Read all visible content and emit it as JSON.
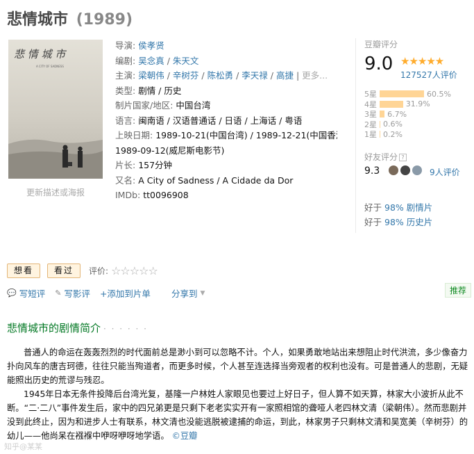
{
  "title": {
    "name": "悲情城市",
    "year": "(1989)"
  },
  "poster": {
    "update_link": "更新描述或海报"
  },
  "info": {
    "director": {
      "label": "导演:",
      "names": [
        "侯孝贤"
      ]
    },
    "writer": {
      "label": "编剧:",
      "names": [
        "吴念真",
        "朱天文"
      ]
    },
    "cast": {
      "label": "主演:",
      "names": [
        "梁朝伟",
        "辛树芬",
        "陈松勇",
        "李天禄",
        "高捷"
      ],
      "more": "更多..."
    },
    "genre": {
      "label": "类型:",
      "value": "剧情 / 历史"
    },
    "region": {
      "label": "制片国家/地区:",
      "value": "中国台湾"
    },
    "language": {
      "label": "语言:",
      "value": "闽南语 / 汉语普通话 / 日语 / 上海话 / 粤语"
    },
    "release": {
      "label": "上映日期:",
      "line1": "1989-10-21(中国台湾) / 1989-12-21(中国香港) /",
      "line2": "1989-09-12(威尼斯电影节)"
    },
    "runtime": {
      "label": "片长:",
      "value": "157分钟"
    },
    "aka": {
      "label": "又名:",
      "value": "A City of Sadness / A Cidade da Dor"
    },
    "imdb": {
      "label": "IMDb:",
      "value": "tt0096908"
    }
  },
  "rating": {
    "label": "豆瓣评分",
    "score": "9.0",
    "stars": "★★★★★",
    "votes": "127527人评价",
    "distribution": [
      {
        "label": "5星",
        "pct": "60.5%",
        "value": 60.5
      },
      {
        "label": "4星",
        "pct": "31.9%",
        "value": 31.9
      },
      {
        "label": "3星",
        "pct": "6.7%",
        "value": 6.7
      },
      {
        "label": "2星",
        "pct": "0.6%",
        "value": 0.6
      },
      {
        "label": "1星",
        "pct": "0.2%",
        "value": 0.2
      }
    ],
    "friend_label": "好友评分",
    "friend_help": "?",
    "friend_score": "9.3",
    "friend_count": "9人评价",
    "better": [
      {
        "prefix": "好于",
        "pct": "98%",
        "genre": "剧情片"
      },
      {
        "prefix": "好于",
        "pct": "98%",
        "genre": "历史片"
      }
    ]
  },
  "actions": {
    "want": "想看",
    "seen": "看过",
    "rate_label": "评价:",
    "empty_stars": "☆☆☆☆☆"
  },
  "links": {
    "short_review": "写短评",
    "review": "写影评",
    "add_list": "+添加到片单",
    "share": "分享到",
    "recommend": "推荐"
  },
  "synopsis": {
    "title": "悲情城市的剧情简介",
    "dots": "· · · · · ·",
    "p1": "普通人的命运在轰轰烈烈的时代面前总是渺小到可以忽略不计。个人，如果勇敢地站出来想阻止时代洪流，多少像奋力扑向风车的唐吉珂德，往往只能当殉道者，而更多时候，个人甚至连选择当旁观者的权利也没有。可是普通人的悲剧，无疑能照出历史的荒谬与残忍。",
    "p2": "1945年日本无条件投降后台湾光复，基隆一户林姓人家眼见也要过上好日子，但人算不如天算，林家大小波折从此不断。“二·二八”事件发生后，家中的四兄弟更是只剩下老老实实开有一家照相馆的聋哑人老四林文清（梁朝伟）。然而悲剧并没到此终止，因为和进步人士有联系，林文清也没能逃脱被逮捕的命运，到此，林家男子只剩林文清和吴宽美（辛树芬）的幼儿——他尚呆在襁褓中咿呀咿呀地学语。",
    "credit": "©豆瓣"
  },
  "watermark": "知乎@某某"
}
